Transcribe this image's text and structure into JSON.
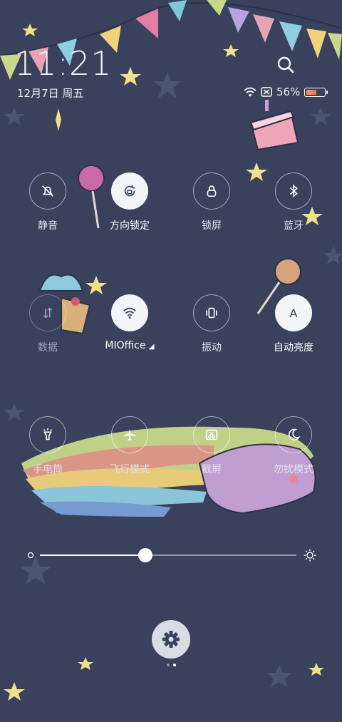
{
  "status": {
    "time": "11:21",
    "date": "12月7日 周五",
    "battery_percent_text": "56%",
    "battery_level": 0.56
  },
  "tiles": [
    {
      "label": "静音",
      "active": false
    },
    {
      "label": "方向锁定",
      "active": true
    },
    {
      "label": "锁屏",
      "active": false
    },
    {
      "label": "蓝牙",
      "active": false
    },
    {
      "label": "数据",
      "active": false
    },
    {
      "label": "MIOffice",
      "active": true
    },
    {
      "label": "振动",
      "active": false
    },
    {
      "label": "自动亮度",
      "active": true
    },
    {
      "label": "手电筒",
      "active": false
    },
    {
      "label": "飞行模式",
      "active": false
    },
    {
      "label": "截屏",
      "active": false
    },
    {
      "label": "勿扰模式",
      "active": false
    }
  ],
  "auto_brightness_glyph": "A",
  "brightness": {
    "level": 0.41
  },
  "pager": {
    "pages": 2,
    "current": 2
  },
  "colors": {
    "background": "#39415c",
    "active_tile": "#f4f5f8"
  }
}
